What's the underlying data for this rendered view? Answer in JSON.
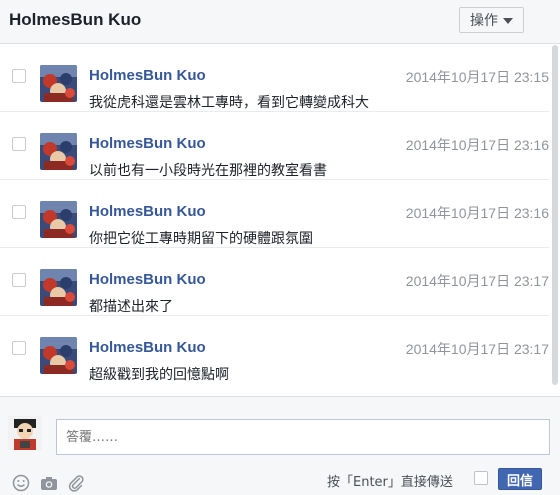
{
  "header": {
    "title": "HolmesBun Kuo",
    "actions_label": "操作"
  },
  "messages": [
    {
      "sender": "HolmesBun Kuo",
      "time": "2014年10月17日 23:15",
      "text": "我從虎科還是雲林工專時，看到它轉變成科大"
    },
    {
      "sender": "HolmesBun Kuo",
      "time": "2014年10月17日 23:16",
      "text": "以前也有一小段時光在那裡的教室看書"
    },
    {
      "sender": "HolmesBun Kuo",
      "time": "2014年10月17日 23:16",
      "text": "你把它從工專時期留下的硬體跟氛圍"
    },
    {
      "sender": "HolmesBun Kuo",
      "time": "2014年10月17日 23:17",
      "text": "都描述出來了"
    },
    {
      "sender": "HolmesBun Kuo",
      "time": "2014年10月17日 23:17",
      "text": "超級戳到我的回憶點啊"
    }
  ],
  "composer": {
    "placeholder": "答覆……",
    "enter_label": "按「Enter」直接傳送",
    "reply_label": "回信"
  },
  "colors": {
    "name_blue": "#365899",
    "button_blue": "#4267b2",
    "timestamp_gray": "#90949c"
  }
}
